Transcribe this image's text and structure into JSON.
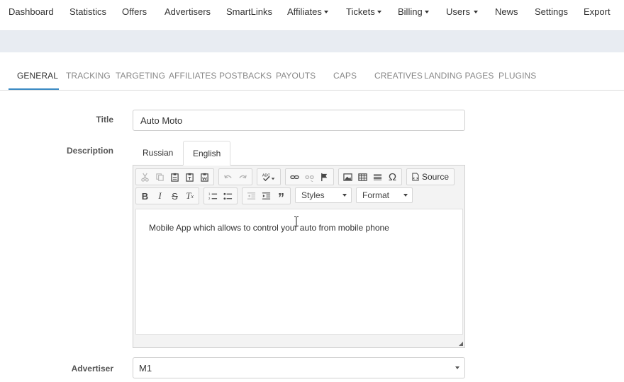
{
  "topnav": {
    "items": [
      {
        "label": "Dashboard",
        "dropdown": false
      },
      {
        "label": "Statistics",
        "dropdown": false
      },
      {
        "label": "Offers",
        "dropdown": false
      },
      {
        "label": "Advertisers",
        "dropdown": false
      },
      {
        "label": "SmartLinks",
        "dropdown": false
      },
      {
        "label": "Affiliates",
        "dropdown": true
      },
      {
        "label": "Tickets",
        "dropdown": true
      },
      {
        "label": "Billing",
        "dropdown": true
      },
      {
        "label": "Users",
        "dropdown": true
      },
      {
        "label": "News",
        "dropdown": false
      },
      {
        "label": "Settings",
        "dropdown": false
      },
      {
        "label": "Export",
        "dropdown": false
      }
    ]
  },
  "tabs": {
    "items": [
      "GENERAL",
      "TRACKING",
      "TARGETING",
      "AFFILIATES",
      "POSTBACKS",
      "PAYOUTS",
      "CAPS",
      "CREATIVES",
      "LANDING PAGES",
      "PLUGINS"
    ],
    "active": "GENERAL"
  },
  "form": {
    "title_label": "Title",
    "title_value": "Auto Moto",
    "description_label": "Description",
    "lang_tabs": [
      "Russian",
      "English"
    ],
    "active_lang": "English",
    "editor": {
      "source_label": "Source",
      "styles_label": "Styles",
      "format_label": "Format",
      "content": "Mobile App which allows to control your auto from mobile phone"
    },
    "advertiser_label": "Advertiser",
    "advertiser_value": "M1"
  },
  "colors": {
    "accent": "#3b8ac4",
    "band": "#e8ecf2"
  }
}
